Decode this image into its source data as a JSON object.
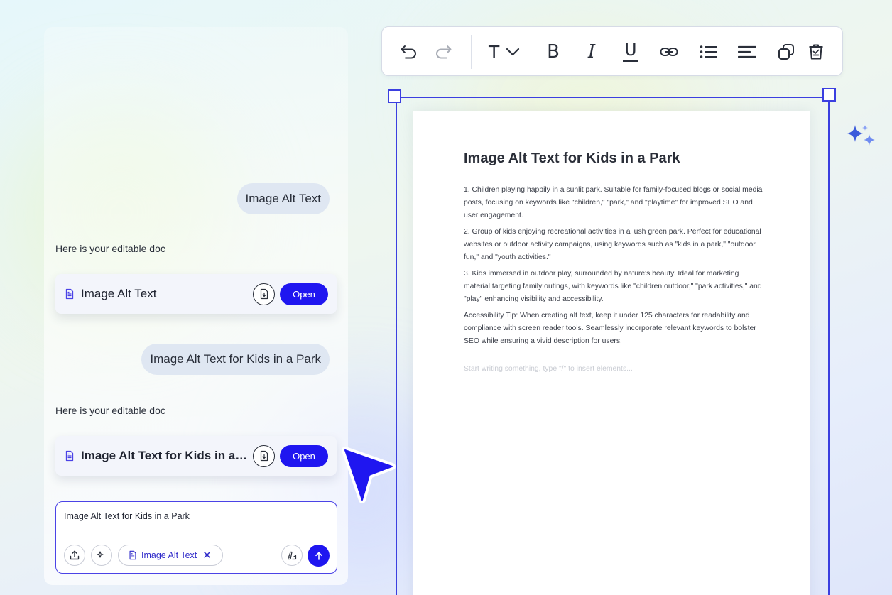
{
  "chat": {
    "messages": [
      {
        "role": "user",
        "text": "Image Alt Text"
      },
      {
        "role": "assistant",
        "text": "Here is your editable doc",
        "doc_card": {
          "title": "Image Alt Text",
          "open_label": "Open"
        }
      },
      {
        "role": "user",
        "text": "Image Alt Text for Kids in a Park"
      },
      {
        "role": "assistant",
        "text": "Here is your editable doc",
        "doc_card": {
          "title": "Image Alt Text for Kids in a Park",
          "open_label": "Open"
        }
      }
    ],
    "composer": {
      "input_value": "Image Alt Text for Kids in a Park",
      "attachment_chip": "Image Alt Text",
      "chip_close": "✕"
    }
  },
  "toolbar": {
    "tools": [
      "undo-icon",
      "redo-icon",
      "text-style-icon",
      "bold-icon",
      "italic-icon",
      "underline-icon",
      "link-icon",
      "bullet-list-icon",
      "align-left-icon",
      "duplicate-icon",
      "delete-icon"
    ],
    "text_style_glyph": "T",
    "bold_glyph": "B",
    "italic_glyph": "I",
    "underline_glyph": "U"
  },
  "document": {
    "title": "Image Alt Text for Kids in a Park",
    "paragraphs": [
      "1. Children playing happily in a sunlit park. Suitable for family-focused blogs or social media posts, focusing on keywords like \"children,\" \"park,\" and \"playtime\" for improved SEO and user engagement.",
      "2. Group of kids enjoying recreational activities in a lush green park. Perfect for educational websites or outdoor activity campaigns, using keywords such as \"kids in a park,\" \"outdoor fun,\" and \"youth activities.\"",
      "3. Kids immersed in outdoor play, surrounded by nature's beauty. Ideal for marketing material targeting family outings, with keywords like \"children outdoor,\" \"park activities,\" and \"play\" enhancing visibility and accessibility.",
      "Accessibility Tip: When creating alt text, keep it under 125 characters for readability and compliance with screen reader tools. Seamlessly incorporate relevant keywords to bolster SEO while ensuring a vivid description for users."
    ],
    "placeholder": "Start writing something, type \"/\" to insert elements..."
  },
  "colors": {
    "accent": "#1f16f0",
    "frame": "#3b3fe0",
    "bubble": "#dfe7f2"
  }
}
